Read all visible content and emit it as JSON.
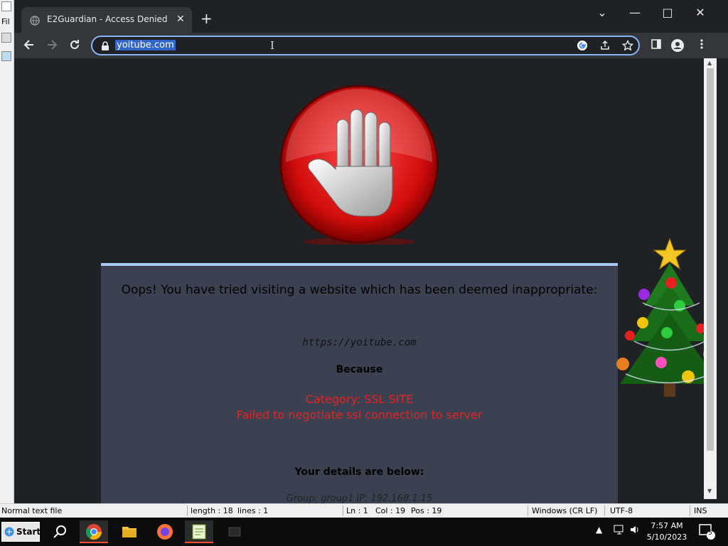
{
  "background_app": {
    "menu_first": "Fil"
  },
  "browser": {
    "tab": {
      "title": "E2Guardian - Access Denied",
      "close": "✕"
    },
    "new_tab": "+",
    "window_controls": {
      "dropdown": "⌄",
      "minimize": "—",
      "maximize": "□",
      "close": "✕"
    },
    "address": {
      "url": "yoitube.com"
    },
    "nav_icons": [
      "back-arrow-icon",
      "forward-arrow-icon",
      "reload-icon"
    ],
    "omnibox_icons": [
      "google-icon",
      "share-icon",
      "star-icon"
    ],
    "toolbar_icons": [
      "side-panel-icon",
      "profile-icon",
      "menu-dots-icon"
    ]
  },
  "page": {
    "oops": "Oops! You have tried visiting a website which has been deemed inappropriate:",
    "blocked_url": "https://yoitube.com",
    "because": "Because",
    "category": "Category: SSL SITE",
    "reason": "Failed to negotiate ssl connection to server",
    "details_heading": "Your details are below:",
    "details_line": "Group: group1   IP: 192.168.1.15"
  },
  "status_bar": {
    "file_type": "Normal text file",
    "length": "length : 18",
    "lines": "lines : 1",
    "ln": "Ln : 1",
    "col": "Col : 19",
    "pos": "Pos : 19",
    "eol": "Windows (CR LF)",
    "encoding": "UTF-8",
    "mode": "INS"
  },
  "taskbar": {
    "start": "Start",
    "apps": [
      "search-icon",
      "chrome-icon",
      "file-explorer-icon",
      "firefox-icon",
      "notepad-plus-plus-icon",
      "app-icon"
    ],
    "time": "7:57 AM",
    "date": "5/10/2023",
    "notification_count": "5"
  },
  "colors": {
    "accent_blue": "#8ab4f8",
    "error_red": "#e52222",
    "panel": "#3b4150",
    "panel_border": "#a7c9f2"
  }
}
